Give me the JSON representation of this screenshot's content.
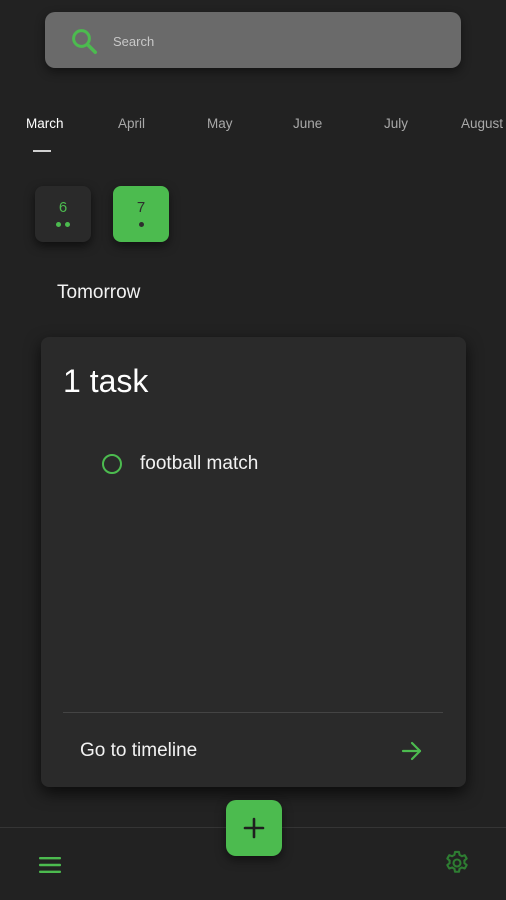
{
  "colors": {
    "background": "#222222",
    "card": "#2a2a2a",
    "accent": "#4cbb4f",
    "search_bg": "#6a6a6a",
    "settings_icon": "#2e7d32"
  },
  "search": {
    "placeholder": "Search",
    "value": ""
  },
  "months": [
    "March",
    "April",
    "May",
    "June",
    "July",
    "August"
  ],
  "selected_month": "March",
  "days": [
    {
      "number": "6",
      "dots": 2,
      "selected": false
    },
    {
      "number": "7",
      "dots": 1,
      "selected": true
    }
  ],
  "section_label": "Tomorrow",
  "card": {
    "title": "1 task",
    "tasks": [
      {
        "label": "football match",
        "done": false
      }
    ],
    "link_label": "Go to timeline"
  },
  "icons": {
    "search": "search-icon",
    "arrow": "arrow-right-icon",
    "add": "plus-icon",
    "menu": "hamburger-menu-icon",
    "settings": "gear-icon"
  }
}
